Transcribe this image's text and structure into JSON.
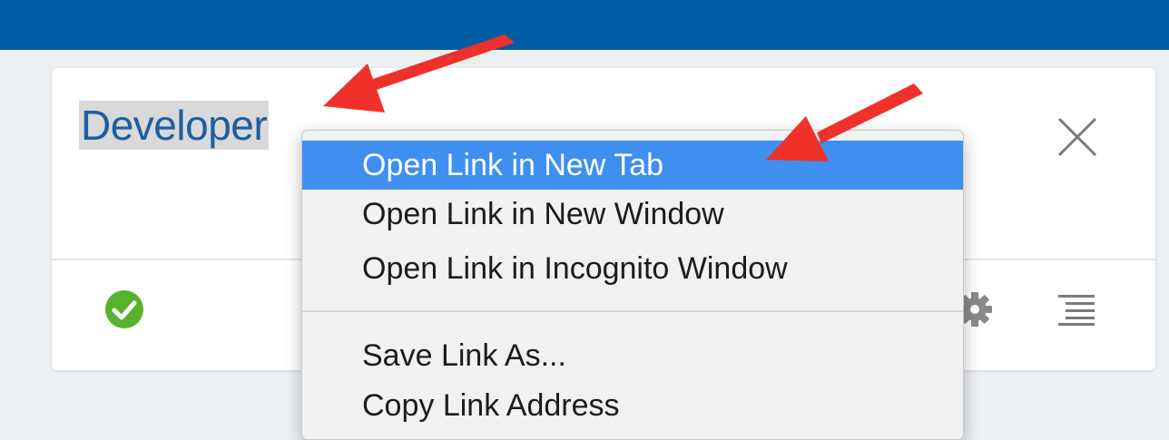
{
  "card": {
    "title": "Developer"
  },
  "context_menu": {
    "items": [
      {
        "label": "Open Link in New Tab",
        "active": true
      },
      {
        "label": "Open Link in New Window",
        "active": false
      },
      {
        "label": "Open Link in Incognito Window",
        "active": false
      },
      {
        "label": "Save Link As...",
        "active": false
      },
      {
        "label": "Copy Link Address",
        "active": false
      }
    ]
  },
  "icons": {
    "close": "close-icon",
    "status": "check-circle-icon",
    "settings": "gear-icon",
    "menu": "menu-lines-icon"
  },
  "colors": {
    "topbar": "#005ca3",
    "link_text": "#1d5ea0",
    "menu_highlight": "#3f8ff0",
    "status_ok": "#5ab22c",
    "annotation_arrow": "#f0302a"
  }
}
